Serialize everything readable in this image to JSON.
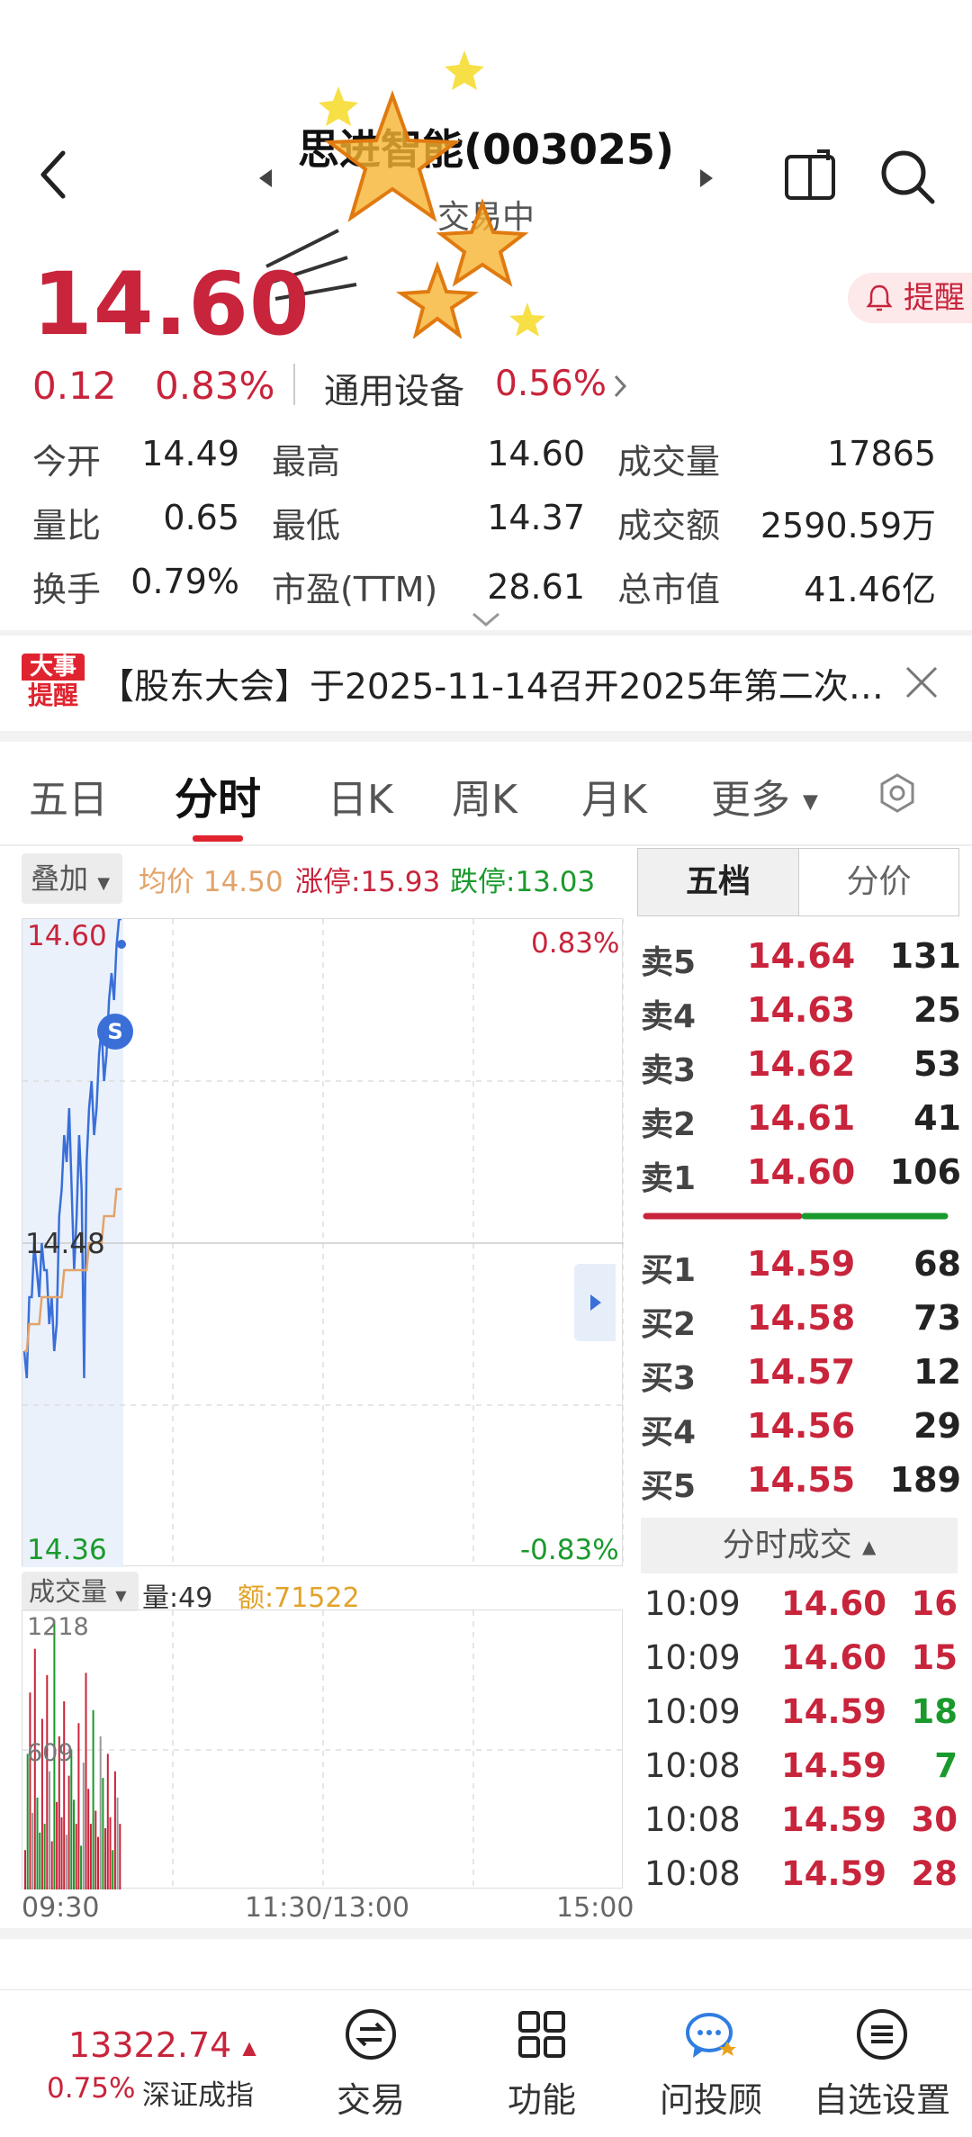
{
  "header": {
    "title": "思进智能(003025)",
    "status": "交易中"
  },
  "quote": {
    "price": "14.60",
    "change": "0.12",
    "change_pct": "0.83%",
    "sector": "通用设备",
    "sector_pct": "0.56%",
    "remind_label": "提醒"
  },
  "stats": {
    "open_label": "今开",
    "open": "14.49",
    "high_label": "最高",
    "high": "14.60",
    "vol_label": "成交量",
    "vol": "17865",
    "ratio_label": "量比",
    "ratio": "0.65",
    "low_label": "最低",
    "low": "14.37",
    "amount_label": "成交额",
    "amount": "2590.59万",
    "turnover_label": "换手",
    "turnover": "0.79%",
    "pe_label": "市盈(TTM)",
    "pe": "28.61",
    "mcap_label": "总市值",
    "mcap": "41.46亿"
  },
  "news": {
    "badge_top": "大事",
    "badge_bottom": "提醒",
    "text": "【股东大会】于2025-11-14召开2025年第二次…"
  },
  "tabs": [
    "五日",
    "分时",
    "日K",
    "周K",
    "月K",
    "更多"
  ],
  "chart_info": {
    "overlay": "叠加",
    "avg_label": "均价 14.50",
    "limit_up": "涨停:15.93",
    "limit_down": "跌停:13.03",
    "y_top": "14.60",
    "y_mid": "14.48",
    "y_bot": "14.36",
    "pct_top": "0.83%",
    "pct_bot": "-0.83%",
    "vol_btn": "成交量",
    "vol_now": "量:49",
    "amt_now": "额:71522",
    "vol_max": "1218",
    "vol_mid": "609",
    "t_start": "09:30",
    "t_mid": "11:30/13:00",
    "t_end": "15:00",
    "s_marker": "S"
  },
  "chart_data": {
    "type": "line",
    "title": "",
    "x": [
      0,
      1,
      2,
      3,
      4,
      5,
      6,
      7,
      8,
      9,
      10,
      11,
      12,
      13,
      14,
      15,
      16,
      17,
      18,
      19,
      20,
      21,
      22,
      23,
      24,
      25,
      26,
      27,
      28,
      29,
      30,
      31,
      32,
      33,
      34,
      35,
      36,
      37,
      38,
      39
    ],
    "series": [
      {
        "name": "",
        "color": "#3a6fd8",
        "values": [
          14.44,
          14.43,
          14.46,
          14.46,
          14.48,
          14.47,
          14.46,
          14.48,
          14.47,
          14.47,
          14.45,
          14.46,
          14.44,
          14.45,
          14.49,
          14.5,
          14.52,
          14.51,
          14.53,
          14.5,
          14.47,
          14.49,
          14.52,
          14.5,
          14.43,
          14.51,
          14.53,
          14.54,
          14.52,
          14.53,
          14.55,
          14.56,
          14.54,
          14.55,
          14.57,
          14.58,
          14.57,
          14.59,
          14.6,
          14.6
        ]
      },
      {
        "name": "均价",
        "color": "#e2a36a",
        "values": [
          14.44,
          14.44,
          14.45,
          14.45,
          14.45,
          14.45,
          14.45,
          14.46,
          14.46,
          14.46,
          14.46,
          14.46,
          14.46,
          14.46,
          14.46,
          14.46,
          14.47,
          14.47,
          14.47,
          14.47,
          14.47,
          14.47,
          14.47,
          14.47,
          14.47,
          14.47,
          14.48,
          14.48,
          14.48,
          14.48,
          14.48,
          14.48,
          14.49,
          14.49,
          14.49,
          14.49,
          14.49,
          14.5,
          14.5,
          14.5
        ]
      }
    ],
    "ylim": [
      14.36,
      14.6
    ],
    "volume": [
      180,
      620,
      900,
      350,
      1100,
      420,
      260,
      780,
      300,
      980,
      540,
      220,
      1218,
      400,
      700,
      330,
      860,
      250,
      520,
      640,
      410,
      300,
      760,
      200,
      580,
      990,
      460,
      300,
      820,
      360,
      240,
      700,
      510,
      280,
      620,
      330,
      180,
      540,
      420,
      300
    ],
    "volume_ylim": [
      0,
      1218
    ]
  },
  "orderbook": {
    "tab_active": "五档",
    "tab_other": "分价",
    "asks": [
      {
        "label": "卖5",
        "price": "14.64",
        "vol": "131"
      },
      {
        "label": "卖4",
        "price": "14.63",
        "vol": "25"
      },
      {
        "label": "卖3",
        "price": "14.62",
        "vol": "53"
      },
      {
        "label": "卖2",
        "price": "14.61",
        "vol": "41"
      },
      {
        "label": "卖1",
        "price": "14.60",
        "vol": "106"
      }
    ],
    "bids": [
      {
        "label": "买1",
        "price": "14.59",
        "vol": "68"
      },
      {
        "label": "买2",
        "price": "14.58",
        "vol": "73"
      },
      {
        "label": "买3",
        "price": "14.57",
        "vol": "12"
      },
      {
        "label": "买4",
        "price": "14.56",
        "vol": "29"
      },
      {
        "label": "买5",
        "price": "14.55",
        "vol": "189"
      }
    ],
    "ticks_title": "分时成交",
    "ticks": [
      {
        "time": "10:09",
        "price": "14.60",
        "vol": "16",
        "dir": "up"
      },
      {
        "time": "10:09",
        "price": "14.60",
        "vol": "15",
        "dir": "up"
      },
      {
        "time": "10:09",
        "price": "14.59",
        "vol": "18",
        "dir": "down"
      },
      {
        "time": "10:08",
        "price": "14.59",
        "vol": "7",
        "dir": "down"
      },
      {
        "time": "10:08",
        "price": "14.59",
        "vol": "30",
        "dir": "up"
      },
      {
        "time": "10:08",
        "price": "14.59",
        "vol": "28",
        "dir": "up"
      }
    ]
  },
  "bottom": {
    "index_value": "13322.74",
    "index_pct": "0.75%",
    "index_name": "深证成指",
    "trade": "交易",
    "functions": "功能",
    "advisor": "问投顾",
    "settings": "自选设置"
  }
}
